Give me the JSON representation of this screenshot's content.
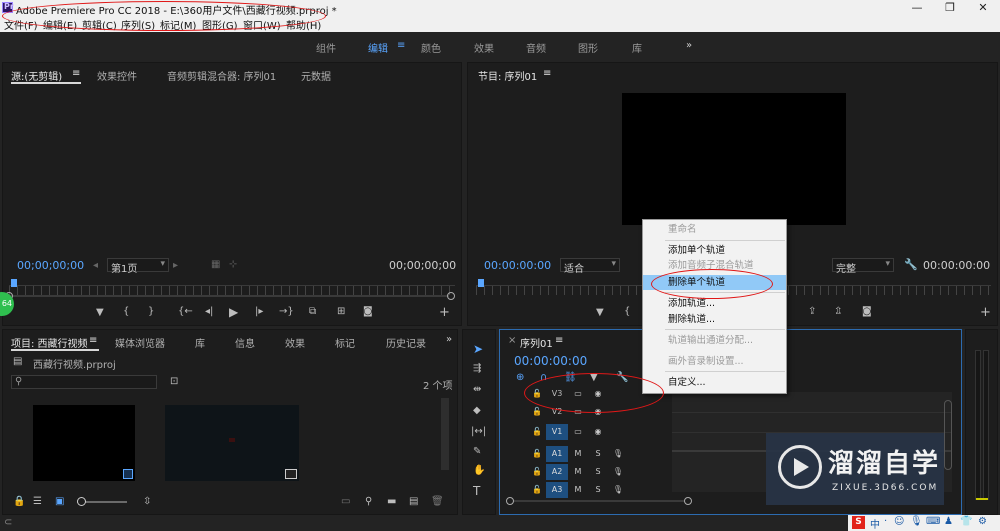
{
  "window": {
    "logo": "Pr",
    "title": "Adobe Premiere Pro CC 2018 - E:\\360用户文件\\西藏行视频.prproj *",
    "controls": [
      "—",
      "❐",
      "✕"
    ]
  },
  "menu": [
    "文件(F)",
    "编辑(E)",
    "剪辑(C)",
    "序列(S)",
    "标记(M)",
    "图形(G)",
    "窗口(W)",
    "帮助(H)"
  ],
  "workspaces": {
    "tabs": [
      "组件",
      "编辑",
      "颜色",
      "效果",
      "音频",
      "图形",
      "库"
    ],
    "active": "编辑",
    "menu_glyph": "≡",
    "more": "»"
  },
  "source_panel": {
    "tabs": [
      "源:(无剪辑)",
      "效果控件",
      "音频剪辑混合器: 序列01",
      "元数据"
    ],
    "menu_glyph": "≡",
    "timecode_left": "00;00;00;00",
    "page_select": "第1页",
    "timecode_right": "00;00;00;00"
  },
  "program_panel": {
    "title": "节目: 序列01",
    "menu_glyph": "≡",
    "timecode_left": "00:00:00:00",
    "fit": "适合",
    "quality": "完整",
    "timecode_right": "00:00:00:00"
  },
  "project_panel": {
    "tabs": [
      "项目: 西藏行视频",
      "媒体浏览器",
      "库",
      "信息",
      "效果",
      "标记",
      "历史记录"
    ],
    "menu_glyph": "≡",
    "more": "»",
    "file": "西藏行视频.prproj",
    "item_count": "2 个项"
  },
  "timeline": {
    "tab": "序列01",
    "close": "×",
    "menu_glyph": "≡",
    "timecode": "00:00:00:00",
    "tracks": [
      {
        "name": "V3",
        "target": false,
        "toggles": [
          "▭",
          "◉"
        ]
      },
      {
        "name": "V2",
        "target": false,
        "toggles": [
          "▭",
          "◉"
        ]
      },
      {
        "name": "V1",
        "target": true,
        "toggles": [
          "▭",
          "◉"
        ]
      },
      {
        "name": "A1",
        "target": true,
        "toggles": [
          "M",
          "S",
          "🎙"
        ]
      },
      {
        "name": "A2",
        "target": true,
        "toggles": [
          "M",
          "S",
          "🎙"
        ]
      },
      {
        "name": "A3",
        "target": true,
        "toggles": [
          "M",
          "S",
          "🎙"
        ]
      }
    ]
  },
  "context_menu": {
    "items": [
      {
        "label": "重命名",
        "disabled": true,
        "highlight": false
      },
      {
        "label": "添加单个轨道",
        "disabled": false,
        "highlight": false
      },
      {
        "label": "添加音频子混合轨道",
        "disabled": true,
        "highlight": false
      },
      {
        "label": "删除单个轨道",
        "disabled": false,
        "highlight": true
      },
      {
        "label": "添加轨道...",
        "disabled": false,
        "highlight": false
      },
      {
        "label": "删除轨道...",
        "disabled": false,
        "highlight": false
      },
      {
        "label": "轨道输出通道分配...",
        "disabled": true,
        "highlight": false
      },
      {
        "label": "画外音录制设置...",
        "disabled": true,
        "highlight": false
      },
      {
        "label": "自定义...",
        "disabled": false,
        "highlight": false
      }
    ]
  },
  "badge": "64",
  "watermark": {
    "title": "溜溜自学",
    "url": "ZIXUE.3D66.COM"
  },
  "tray": [
    "S",
    "中",
    "·",
    "☺",
    "🎙",
    "⌨",
    "♟",
    "👕",
    "⚙"
  ],
  "colors": {
    "accent": "#5aa6ff",
    "annotation": "#e01818",
    "menu_highlight": "#91c9f7"
  }
}
